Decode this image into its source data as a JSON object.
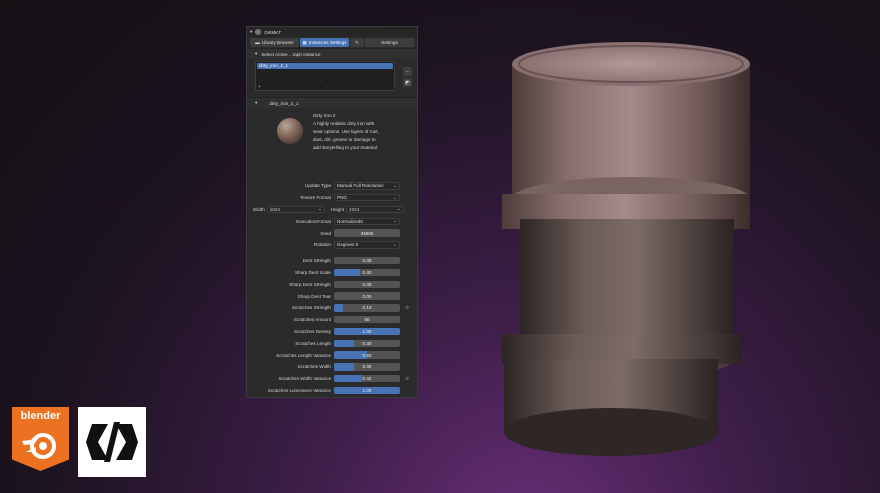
{
  "panel": {
    "title": "DirtMKT",
    "tabs": [
      "Library Browser",
      "Instances Settings",
      "Settings"
    ],
    "select_section": "Select Active ...raph Instance",
    "list_selected": "dirty_iron_2_1",
    "instance_section": "dirty_iron_2_1",
    "material": {
      "name": "Dirty Iron 2",
      "description": "A highly realistic dirty iron with wear options. Use layers of rust, dust, dirt, grease or damage to add storytelling to your material."
    },
    "update_type": {
      "label": "Update Type",
      "value": "Manual Full Resolution"
    },
    "texture_format": {
      "label": "Texture Format",
      "value": "PNG"
    },
    "width": {
      "label": "Width",
      "value": "1024"
    },
    "height": {
      "label": "Height",
      "value": "1024"
    },
    "execution_format": {
      "label": "ExecutionFormat",
      "value": "Normalized8"
    },
    "seed": {
      "label": "Seed",
      "value": "34695"
    },
    "rotation": {
      "label": "Rotation",
      "value": "Degrees 0"
    },
    "params": [
      {
        "label": "Dent Strength",
        "value": "0.00",
        "fill": 0.0,
        "reset": false
      },
      {
        "label": "Sharp Dent Scale",
        "value": "0.40",
        "fill": 0.4,
        "reset": false
      },
      {
        "label": "Sharp Dent Strength",
        "value": "0.00",
        "fill": 0.0,
        "reset": false
      },
      {
        "label": "Sharp Dent Tear",
        "value": "0.00",
        "fill": 0.0,
        "reset": false
      },
      {
        "label": "Scratches Strength",
        "value": "0.13",
        "fill": 0.13,
        "reset": true
      },
      {
        "label": "Scratches Amount",
        "value": "50",
        "fill": 0.0,
        "reset": false
      },
      {
        "label": "Scratches Density",
        "value": "1.00",
        "fill": 1.0,
        "reset": false
      },
      {
        "label": "Scratches Length",
        "value": "0.30",
        "fill": 0.3,
        "reset": false
      },
      {
        "label": "Scratches Length Variance",
        "value": "0.50",
        "fill": 0.5,
        "reset": false
      },
      {
        "label": "Scratches Width",
        "value": "0.30",
        "fill": 0.3,
        "reset": false
      },
      {
        "label": "Scratches Width Variance",
        "value": "0.42",
        "fill": 0.42,
        "reset": true
      },
      {
        "label": "Scratches Luminance Variance",
        "value": "1.00",
        "fill": 1.0,
        "reset": false
      }
    ]
  },
  "logos": {
    "blender": "blender"
  },
  "colors": {
    "accent": "#4772b3",
    "blender_orange": "#ec7222"
  }
}
